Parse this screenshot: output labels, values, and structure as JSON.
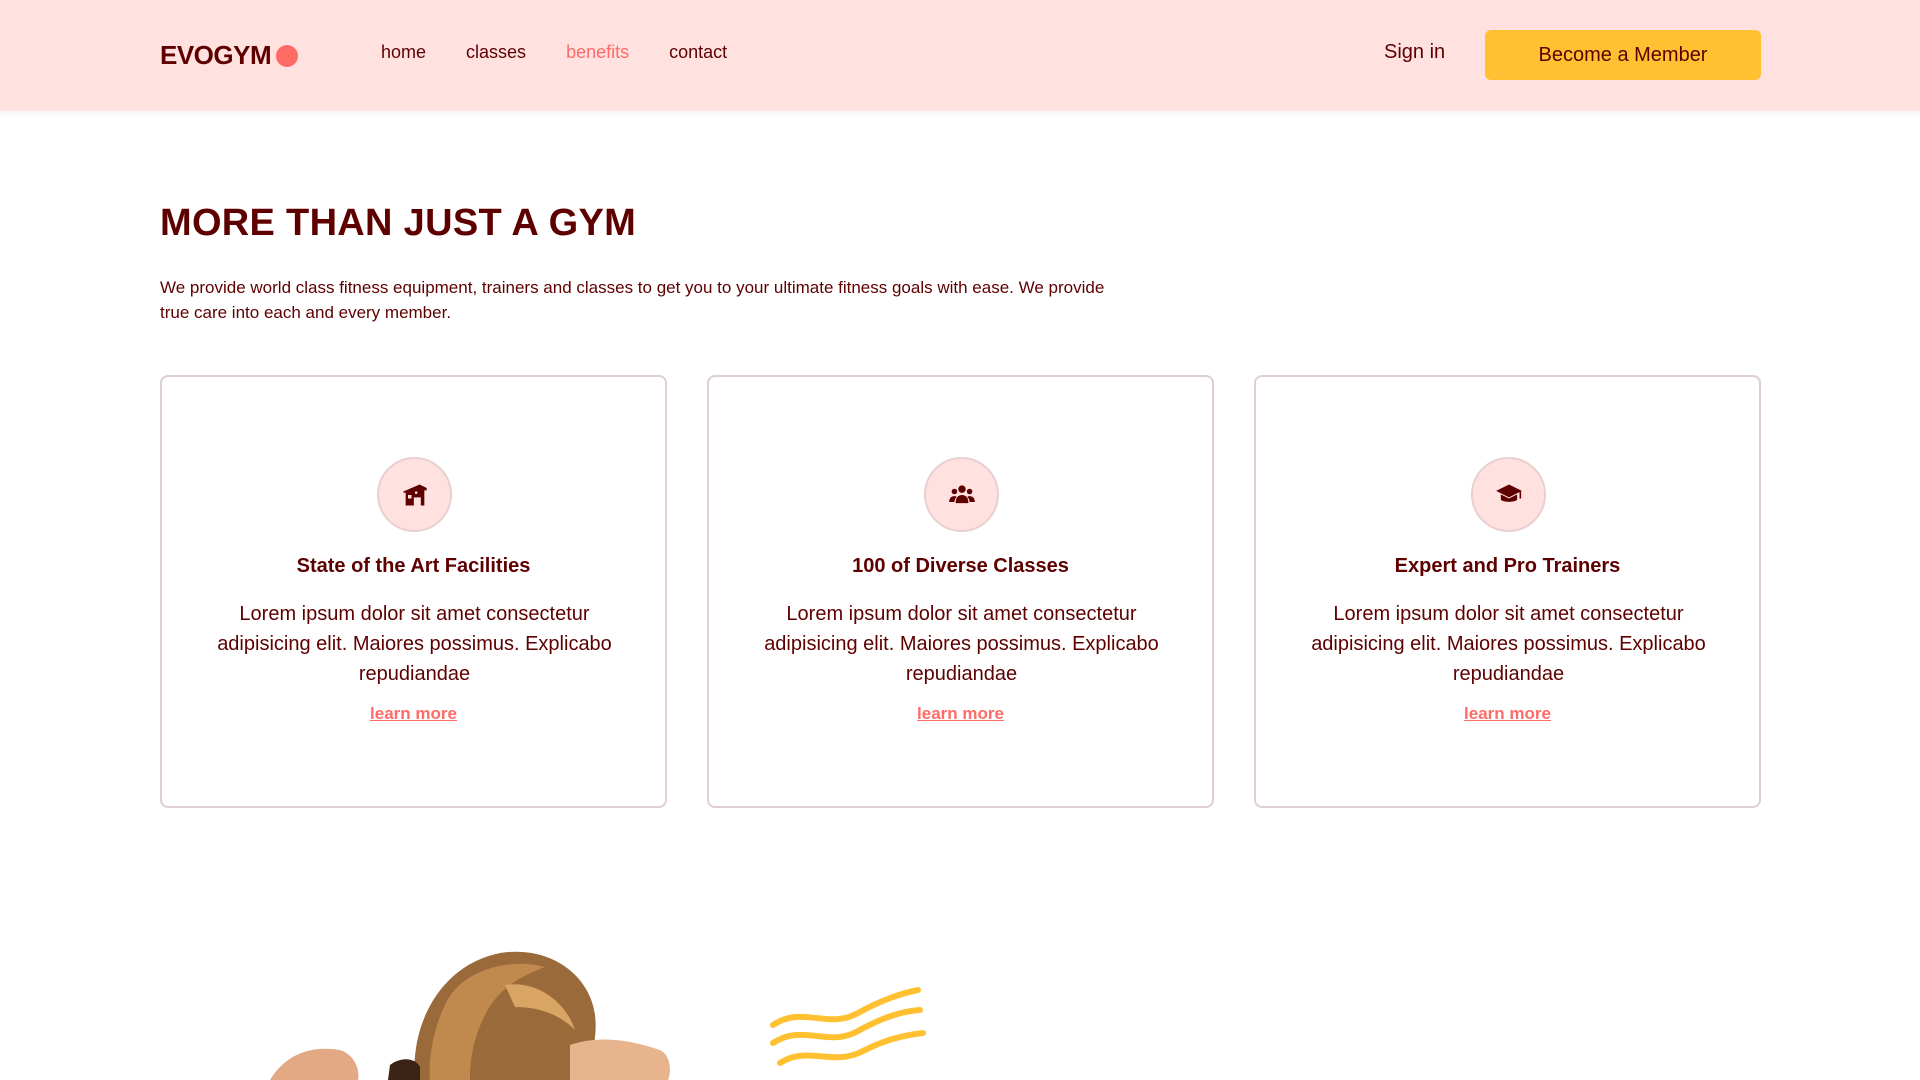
{
  "nav": {
    "logo_text": "EVOGYM",
    "links": [
      {
        "label": "home",
        "active": false
      },
      {
        "label": "classes",
        "active": false
      },
      {
        "label": "benefits",
        "active": true
      },
      {
        "label": "contact",
        "active": false
      }
    ],
    "sign_in": "Sign in",
    "cta": "Become a Member"
  },
  "section": {
    "title": "MORE THAN JUST A GYM",
    "description": "We provide world class fitness equipment, trainers and classes to get you to your ultimate fitness goals with ease. We provide true care into each and every member."
  },
  "cards": [
    {
      "icon": "home-modern-icon",
      "title": "State of the Art Facilities",
      "text": "Lorem ipsum dolor sit amet consectetur adipisicing elit. Maiores possimus. Explicabo repudiandae",
      "link": "learn more"
    },
    {
      "icon": "user-group-icon",
      "title": "100 of Diverse Classes",
      "text": "Lorem ipsum dolor sit amet consectetur adipisicing elit. Maiores possimus. Explicabo repudiandae",
      "link": "learn more"
    },
    {
      "icon": "academic-cap-icon",
      "title": "Expert and Pro Trainers",
      "text": "Lorem ipsum dolor sit amet consectetur adipisicing elit. Maiores possimus. Explicabo repudiandae",
      "link": "learn more"
    }
  ],
  "colors": {
    "primary": "#5e0000",
    "nav_bg": "#ffe1e0",
    "accent": "#ff6b66",
    "cta_bg": "#ffc132",
    "card_border": "#e0cfd2"
  }
}
